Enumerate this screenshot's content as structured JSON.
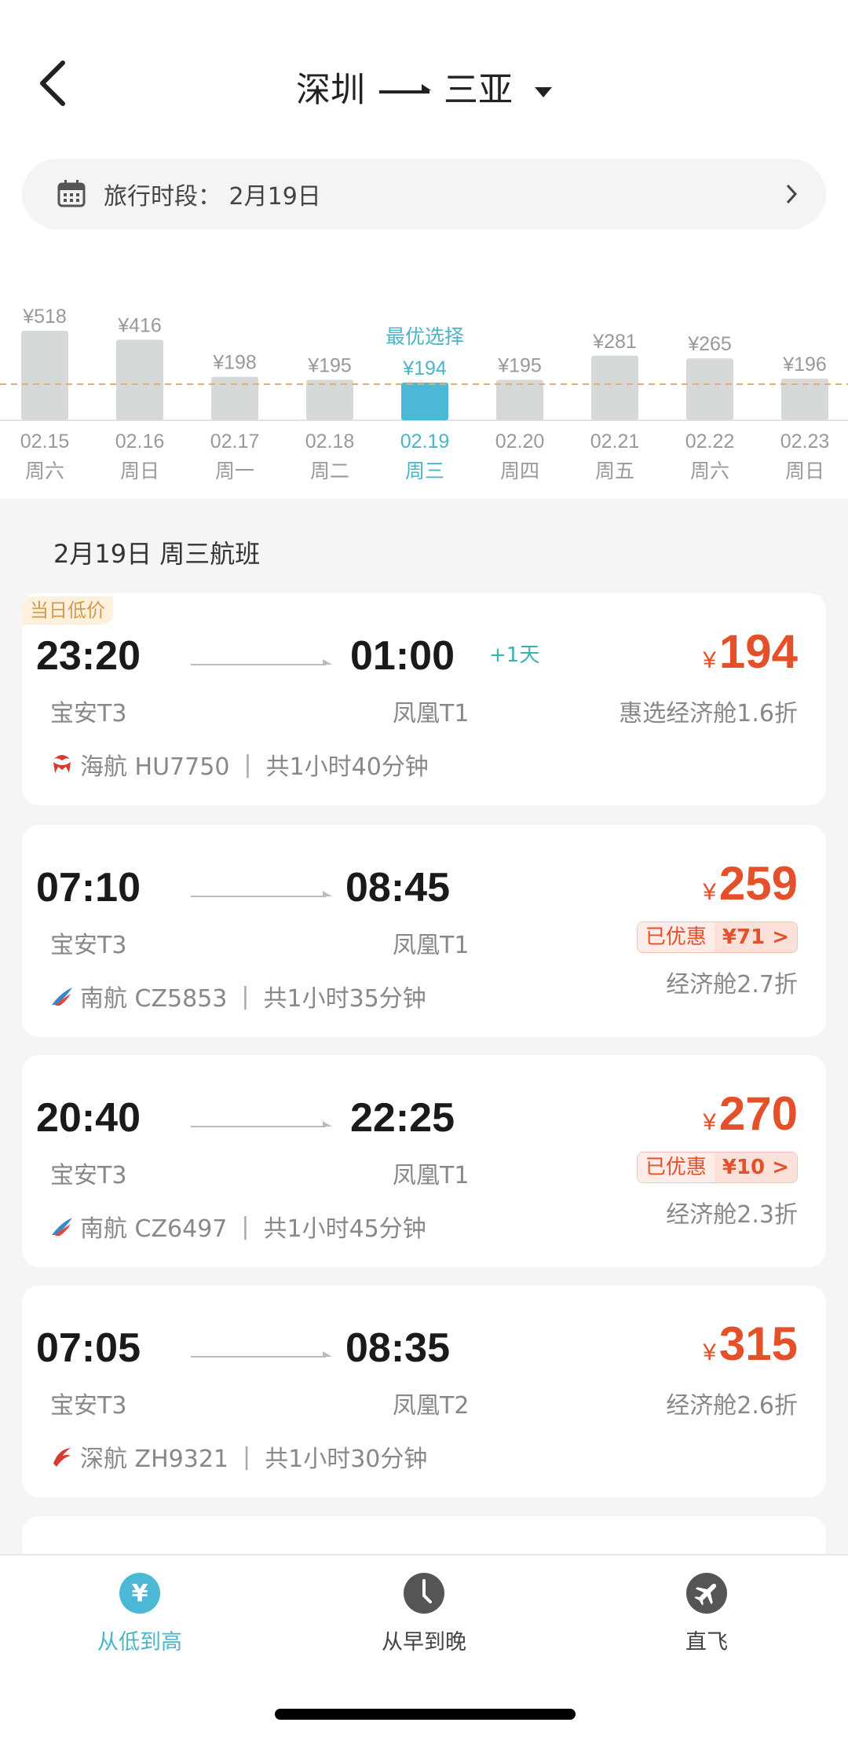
{
  "header": {
    "from": "深圳",
    "to": "三亚"
  },
  "date_bar": {
    "label": "旅行时段：",
    "value": "2月19日"
  },
  "chart_data": {
    "type": "bar",
    "categories": [
      "02.15",
      "02.16",
      "02.17",
      "02.18",
      "02.19",
      "02.20",
      "02.21",
      "02.22",
      "02.23"
    ],
    "weekdays": [
      "周六",
      "周日",
      "周一",
      "周二",
      "周三",
      "周四",
      "周五",
      "周六",
      "周日"
    ],
    "value_labels": [
      "¥518",
      "¥416",
      "¥198",
      "¥195",
      "¥194",
      "¥195",
      "¥281",
      "¥265",
      "¥196"
    ],
    "values": [
      518,
      416,
      198,
      195,
      194,
      195,
      281,
      265,
      196
    ],
    "selected_index": 4,
    "best_label": "最优选择",
    "reference_line": "dashed",
    "colors": {
      "bar": "#d5d9da",
      "selected": "#4bb9d6",
      "reference": "#e0b070",
      "text": "#999999",
      "selected_text": "#4bb5c8"
    }
  },
  "section_title": "2月19日 周三航班",
  "flights": [
    {
      "badge": "当日低价",
      "dep": "23:20",
      "arr": "01:00",
      "next_day": "+1天",
      "dep_ap": "宝安T3",
      "arr_ap": "凤凰T1",
      "airline": "海航 HU7750",
      "logo": "hainan-airlines",
      "duration": "共1小时40分钟",
      "currency": "¥",
      "price": "194",
      "cabin": "惠选经济舱1.6折"
    },
    {
      "dep": "07:10",
      "arr": "08:45",
      "dep_ap": "宝安T3",
      "arr_ap": "凤凰T1",
      "airline": "南航 CZ5853",
      "logo": "china-southern",
      "duration": "共1小时35分钟",
      "currency": "¥",
      "price": "259",
      "promo_label": "已优惠",
      "promo_value": "¥71",
      "cabin": "经济舱2.7折"
    },
    {
      "dep": "20:40",
      "arr": "22:25",
      "dep_ap": "宝安T3",
      "arr_ap": "凤凰T1",
      "airline": "南航 CZ6497",
      "logo": "china-southern",
      "duration": "共1小时45分钟",
      "currency": "¥",
      "price": "270",
      "promo_label": "已优惠",
      "promo_value": "¥10",
      "cabin": "经济舱2.3折"
    },
    {
      "dep": "07:05",
      "arr": "08:35",
      "dep_ap": "宝安T3",
      "arr_ap": "凤凰T2",
      "airline": "深航 ZH9321",
      "logo": "shenzhen-airlines",
      "duration": "共1小时30分钟",
      "currency": "¥",
      "price": "315",
      "cabin": "经济舱2.6折"
    }
  ],
  "bottom_tabs": [
    {
      "label": "从低到高",
      "icon": "yuan-icon",
      "active": true
    },
    {
      "label": "从早到晚",
      "icon": "clock-icon",
      "active": false
    },
    {
      "label": "直飞",
      "icon": "plane-icon",
      "active": false
    }
  ],
  "colors": {
    "accent": "#4bb9d6",
    "price": "#e4502a"
  }
}
